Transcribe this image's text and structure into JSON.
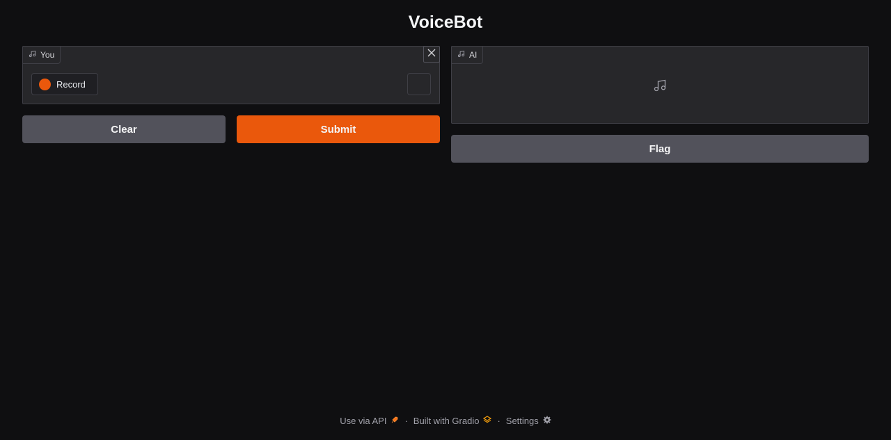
{
  "app": {
    "title": "VoiceBot"
  },
  "input_audio": {
    "label": "You",
    "record_label": "Record",
    "icon": "music-note-icon"
  },
  "output_audio": {
    "label": "AI",
    "icon": "music-note-icon"
  },
  "buttons": {
    "clear": "Clear",
    "submit": "Submit",
    "flag": "Flag"
  },
  "footer": {
    "api": "Use via API",
    "built": "Built with Gradio",
    "settings": "Settings",
    "separator": "·"
  },
  "colors": {
    "accent": "#ea580c",
    "secondary": "#52525b",
    "background": "#0f0f11",
    "panel": "#27272a"
  }
}
